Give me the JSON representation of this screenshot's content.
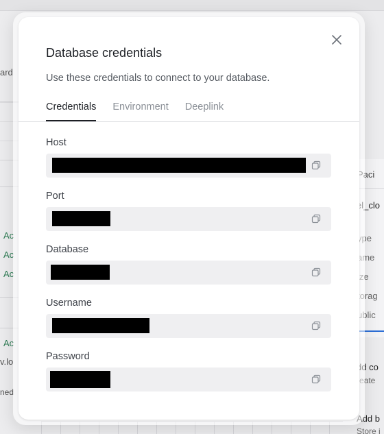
{
  "background": {
    "left_fragments": [
      "ard",
      "Ac",
      "Ac",
      "Ac",
      "Ac",
      "v.lo",
      "ned"
    ],
    "right_panel": {
      "tab": "Paci",
      "title": "el_clo",
      "rows": [
        "ype",
        "ame",
        "ize",
        "torag",
        "ublic"
      ],
      "add_1": "dd co",
      "add_1_sub": "reate",
      "add_2": "Add b",
      "add_2_sub": "Store i"
    }
  },
  "modal": {
    "title": "Database credentials",
    "description": "Use these credentials to connect to your database.",
    "tabs": [
      {
        "label": "Credentials",
        "active": true
      },
      {
        "label": "Environment",
        "active": false
      },
      {
        "label": "Deeplink",
        "active": false
      }
    ],
    "fields": [
      {
        "label": "Host",
        "value": ""
      },
      {
        "label": "Port",
        "value": ""
      },
      {
        "label": "Database",
        "value": ""
      },
      {
        "label": "Username",
        "value": ""
      },
      {
        "label": "Password",
        "value": ""
      }
    ]
  },
  "icons": {
    "close": "close-icon",
    "copy": "copy-icon"
  },
  "colors": {
    "modal_bg": "#ffffff",
    "field_bg": "#efeff1",
    "redaction": "#000000",
    "accent_green": "#2f7d55",
    "accent_blue": "#2d6fd6"
  }
}
